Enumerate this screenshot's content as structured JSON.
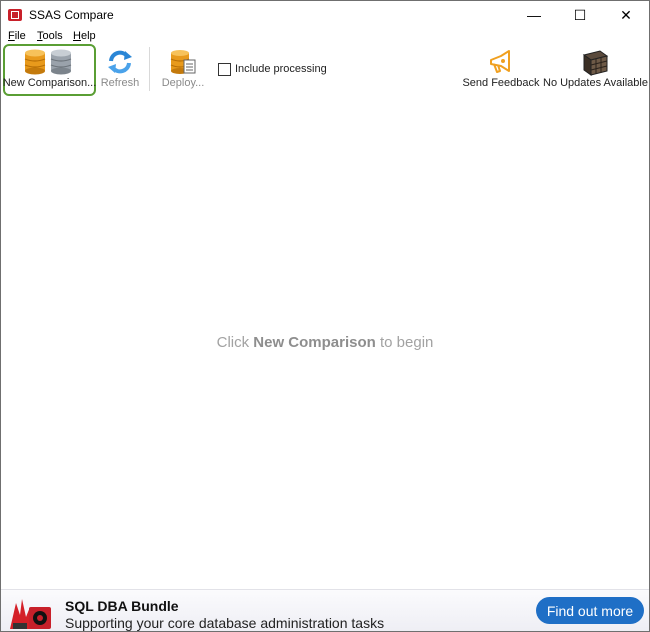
{
  "window": {
    "title": "SSAS Compare",
    "buttons": {
      "minimize": "—",
      "maximize": "☐",
      "close": "✕"
    }
  },
  "menu": {
    "file": {
      "underline": "F",
      "rest": "ile"
    },
    "tools": {
      "underline": "T",
      "rest": "ools"
    },
    "help": {
      "underline": "H",
      "rest": "elp"
    }
  },
  "toolbar": {
    "new_comparison": "New Comparison...",
    "refresh": "Refresh",
    "deploy": "Deploy...",
    "include_processing": "Include processing",
    "include_processing_checked": false,
    "send_feedback": "Send Feedback",
    "updates": "No Updates Available"
  },
  "content": {
    "hint_prefix": "Click",
    "hint_bold": "New Comparison",
    "hint_suffix": "to begin"
  },
  "ad": {
    "title": "SQL DBA Bundle",
    "subtitle": "Supporting your core database administration tasks",
    "cta": "Find out more"
  },
  "colors": {
    "accent_green": "#5a9e34",
    "cta_blue": "#1f6fc6",
    "db_orange": "#e89a1c",
    "db_gray": "#9aa2ab",
    "refresh_blue": "#2a86d6",
    "feedback_orange": "#f0a020"
  }
}
